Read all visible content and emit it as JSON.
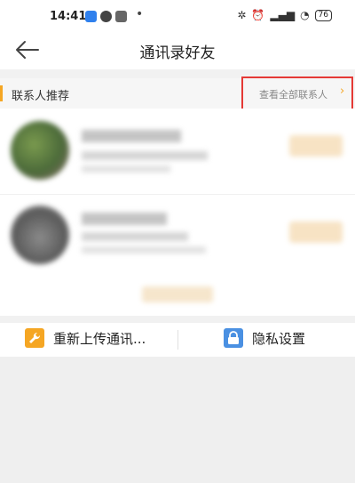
{
  "status_bar": {
    "time": "14:41",
    "app_icons": [
      "app-blue-icon",
      "app-dark-icon",
      "app-gallery-icon"
    ],
    "right_icons": [
      "bluetooth-off-icon",
      "alarm-icon",
      "signal-icon",
      "wifi-icon"
    ],
    "battery": "76"
  },
  "nav": {
    "title": "通讯录好友"
  },
  "section": {
    "title": "联系人推荐",
    "see_all": "查看全部联系人",
    "accent_color": "#f5a623",
    "highlight_color": "#e53935"
  },
  "bottom_bar": {
    "reupload_label": "重新上传通讯...",
    "privacy_label": "隐私设置",
    "reupload_icon_color": "#f5a623",
    "privacy_icon_color": "#4a90e2"
  }
}
